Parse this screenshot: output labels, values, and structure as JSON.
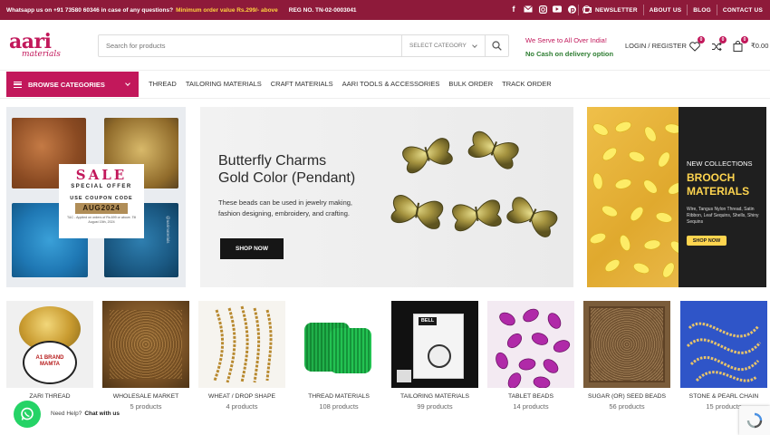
{
  "topbar": {
    "whatsapp": "Whatsapp us on +91 73580 60346 in case of any questions?",
    "min_order": "Minimum order value Rs.299/- above",
    "reg": "REG NO. TN-02-0003041",
    "links": [
      "NEWSLETTER",
      "ABOUT US",
      "BLOG",
      "CONTACT US"
    ],
    "socials": [
      "facebook-icon",
      "email-icon",
      "instagram-icon",
      "youtube-icon",
      "pinterest-icon",
      "whatsapp-icon"
    ]
  },
  "header": {
    "logo_main": "aari",
    "logo_sub": "materials",
    "search_placeholder": "Search for products",
    "category_select": "SELECT CATEGORY",
    "serve_line1": "We Serve to All Over India!",
    "serve_line2": "No Cash on delivery option",
    "login": "LOGIN / REGISTER",
    "wishlist_count": "0",
    "compare_count": "0",
    "cart_count": "0",
    "cart_total": "₹0.00"
  },
  "nav": {
    "browse": "BROWSE CATEGORIES",
    "items": [
      "THREAD",
      "TAILORING MATERIALS",
      "CRAFT MATERIALS",
      "AARI TOOLS & ACCESSORIES",
      "BULK ORDER",
      "TRACK ORDER"
    ]
  },
  "banners": {
    "sale": {
      "title": "SALE",
      "subtitle": "SPECIAL OFFER",
      "use_code": "USE COUPON CODE",
      "code": "AUG2024",
      "terms": "T&C - Applied on orders of Rs.699 or above. Till August 15th, 2024",
      "watermark": "@aarimaterials"
    },
    "charms": {
      "title_line1": "Butterfly Charms",
      "title_line2": "Gold Color (Pendant)",
      "description": "These beads can be used in jewelry making, fashion designing, embroidery, and crafting.",
      "button": "SHOP NOW"
    },
    "brooch": {
      "kicker": "NEW COLLECTIONS",
      "title_line1": "BROOCH",
      "title_line2": "MATERIALS",
      "sub": "Wire, Tangus Nylon Thread, Satin Ribbon, Leaf Sequins, Shells, Shiny Sequins",
      "button": "SHOP NOW"
    }
  },
  "categories": [
    {
      "name": "ZARI THREAD",
      "count": "",
      "color": "#d4b04a",
      "label": "A1 BRAND MAMTA"
    },
    {
      "name": "WHOLESALE MARKET",
      "count": "5 products",
      "color": "#9a6a2e",
      "label": ""
    },
    {
      "name": "WHEAT / DROP SHAPE",
      "count": "4 products",
      "color": "#c29a4a",
      "label": ""
    },
    {
      "name": "THREAD MATERIALS",
      "count": "108 products",
      "color": "#1e9c3a",
      "label": ""
    },
    {
      "name": "TAILORING MATERIALS",
      "count": "99 products",
      "color": "#1b1b1b",
      "label": "BELL"
    },
    {
      "name": "TABLET BEADS",
      "count": "14 products",
      "color": "#a8259e",
      "label": ""
    },
    {
      "name": "SUGAR (OR) SEED BEADS",
      "count": "56 products",
      "color": "#8a6a44",
      "label": ""
    },
    {
      "name": "STONE & PEARL CHAIN",
      "count": "15 products",
      "color": "#d4b25a",
      "label": ""
    }
  ],
  "widgets": {
    "help": "Need Help?",
    "chat": "Chat with us"
  }
}
